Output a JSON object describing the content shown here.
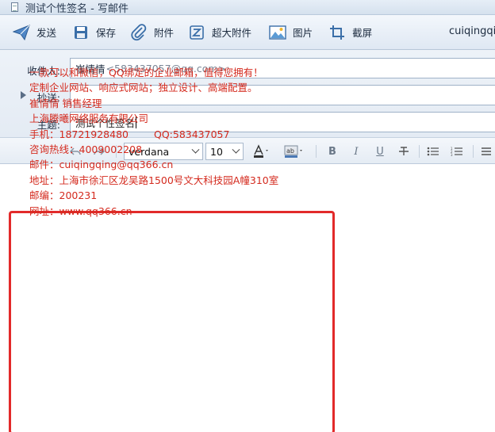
{
  "window": {
    "title": "测试个性签名 - 写邮件"
  },
  "toolbar": {
    "buttons": [
      {
        "id": "send",
        "label": "发送",
        "icon": "send-icon"
      },
      {
        "id": "save",
        "label": "保存",
        "icon": "save-icon"
      },
      {
        "id": "attach",
        "label": "附件",
        "icon": "paperclip-icon"
      },
      {
        "id": "big_attach",
        "label": "超大附件",
        "icon": "big-attachment-icon"
      },
      {
        "id": "image",
        "label": "图片",
        "icon": "image-icon"
      },
      {
        "id": "screenshot",
        "label": "截屏",
        "icon": "crop-icon"
      }
    ],
    "account": "cuiqingqing"
  },
  "fields": {
    "to_label": "收件人:",
    "to_name": "崔情情",
    "to_email": "<583437057@qq.com>;",
    "cc_label": "抄送:",
    "cc_value": "",
    "subject_label": "主题:",
    "subject_value": "测试个性签名"
  },
  "format": {
    "font_family": "verdana",
    "font_size": "10"
  },
  "signature": {
    "lines": [
      "一款可以和微信，QQ绑定的企业邮箱，值得您拥有！",
      "定制企业网站、响应式网站；独立设计、高端配置。",
      "崔情情  销售经理",
      "上海腾曦网络服务有限公司",
      "手机：18721928480",
      "咨询热线：4009002208",
      "邮件：cuiqingqing@qq366.cn",
      "地址：上海市徐汇区龙吴路1500号文大科技园A幢310室",
      "邮编：200231",
      "网址：www.qq366.cn"
    ],
    "qq": "QQ:583437057"
  },
  "colors": {
    "signature_text": "#d42a1e",
    "highlight_box": "#e22a2a"
  }
}
